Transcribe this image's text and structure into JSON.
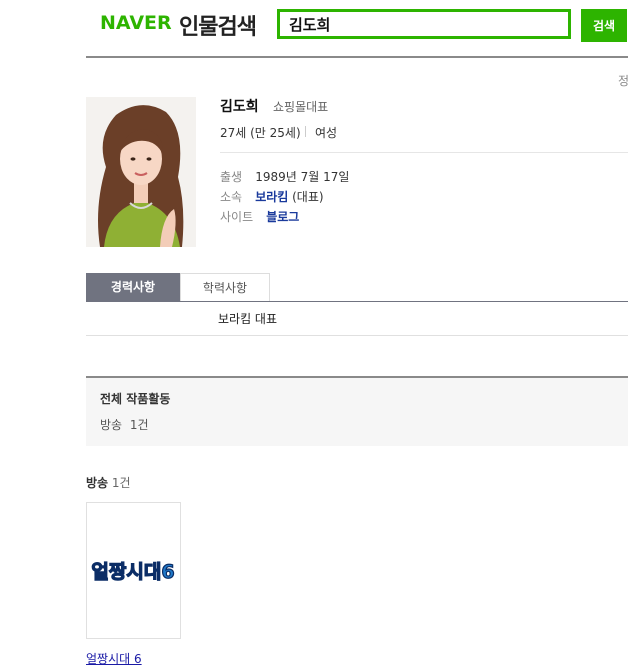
{
  "header": {
    "logo": "NAVER",
    "service": "인물검색",
    "search_value": "김도희",
    "search_button": "검색"
  },
  "corner_text": "정",
  "profile": {
    "name": "김도희",
    "job": "쇼핑몰대표",
    "age": "27세 (만 25세)",
    "gender": "여성",
    "details": [
      {
        "label": "출생",
        "value": "1989년 7월 17일"
      },
      {
        "label": "소속",
        "link": "보라킴",
        "suffix": " (대표)"
      },
      {
        "label": "사이트",
        "link": "블로그"
      }
    ]
  },
  "tabs": [
    "경력사항",
    "학력사항"
  ],
  "career": "보라킴 대표",
  "works_summary": {
    "title": "전체 작품활동",
    "label": "방송",
    "count": "1건"
  },
  "broadcast": {
    "label": "방송",
    "count": "1건",
    "items": [
      {
        "thumb_text": "얼짱시대6",
        "title": "얼짱시대 6"
      }
    ]
  },
  "colors": {
    "brand": "#2db400",
    "tab_active": "#707380",
    "link": "#1a3a9c"
  }
}
